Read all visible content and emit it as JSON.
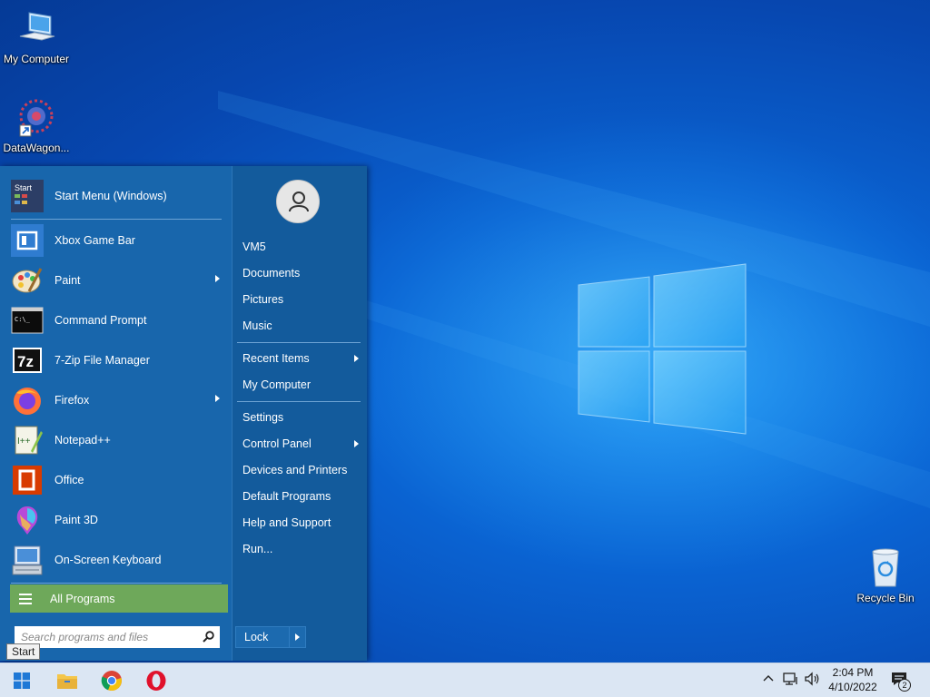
{
  "desktop": {
    "icons": [
      {
        "label": "My Computer"
      },
      {
        "label": "DataWagon..."
      },
      {
        "label": "Recycle Bin"
      }
    ]
  },
  "start_menu": {
    "programs": [
      {
        "label": "Start Menu (Windows)",
        "icon": "start-menu-icon",
        "submenu": false
      },
      {
        "label": "Xbox Game Bar",
        "icon": "xbox-game-bar-icon",
        "submenu": false
      },
      {
        "label": "Paint",
        "icon": "paint-palette-icon",
        "submenu": true
      },
      {
        "label": "Command Prompt",
        "icon": "command-prompt-icon",
        "submenu": false
      },
      {
        "label": "7-Zip File Manager",
        "icon": "seven-zip-icon",
        "submenu": false
      },
      {
        "label": "Firefox",
        "icon": "firefox-icon",
        "submenu": true
      },
      {
        "label": "Notepad++",
        "icon": "notepad-plus-plus-icon",
        "submenu": false
      },
      {
        "label": "Office",
        "icon": "office-icon",
        "submenu": false
      },
      {
        "label": "Paint 3D",
        "icon": "paint-3d-icon",
        "submenu": false
      },
      {
        "label": "On-Screen Keyboard",
        "icon": "on-screen-keyboard-icon",
        "submenu": false
      }
    ],
    "all_programs_label": "All Programs",
    "search_placeholder": "Search programs and files",
    "right_links": [
      {
        "label": "VM5",
        "submenu": false
      },
      {
        "label": "Documents",
        "submenu": false
      },
      {
        "label": "Pictures",
        "submenu": false
      },
      {
        "label": "Music",
        "submenu": false
      },
      {
        "label": "Recent Items",
        "submenu": true
      },
      {
        "label": "My Computer",
        "submenu": false
      },
      {
        "label": "Settings",
        "submenu": false
      },
      {
        "label": "Control Panel",
        "submenu": true
      },
      {
        "label": "Devices and Printers",
        "submenu": false
      },
      {
        "label": "Default Programs",
        "submenu": false
      },
      {
        "label": "Help and Support",
        "submenu": false
      },
      {
        "label": "Run...",
        "submenu": false
      }
    ],
    "lock_label": "Lock"
  },
  "tooltip": {
    "text": "Start"
  },
  "taskbar": {
    "pinned": [
      "windows-start-icon",
      "file-explorer-icon",
      "chrome-icon",
      "opera-icon"
    ],
    "clock": {
      "time": "2:04 PM",
      "date": "4/10/2022"
    },
    "notification_count": "2"
  },
  "colors": {
    "menu_left": "#1866ac",
    "menu_right": "#135b9c",
    "all_programs": "#6ea85a",
    "taskbar": "#dbe6f3"
  }
}
